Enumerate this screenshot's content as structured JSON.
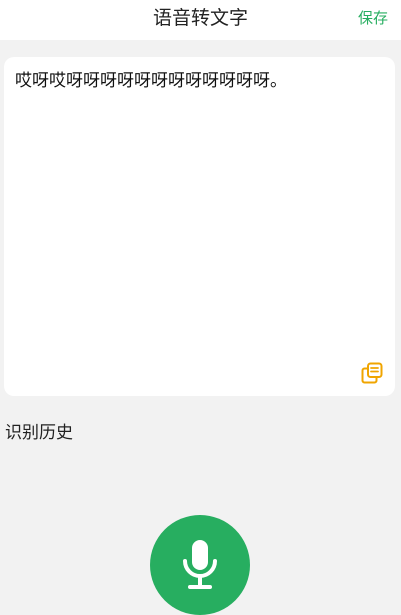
{
  "header": {
    "title": "语音转文字",
    "save_label": "保存"
  },
  "transcript": {
    "text": "哎呀哎呀呀呀呀呀呀呀呀呀呀呀呀。"
  },
  "history": {
    "label": "识别历史"
  },
  "colors": {
    "accent": "#27ae60",
    "copy_icon": "#f0a500",
    "background": "#f2f2f2",
    "card": "#ffffff"
  },
  "icons": {
    "copy": "copy-icon",
    "mic": "microphone-icon"
  }
}
